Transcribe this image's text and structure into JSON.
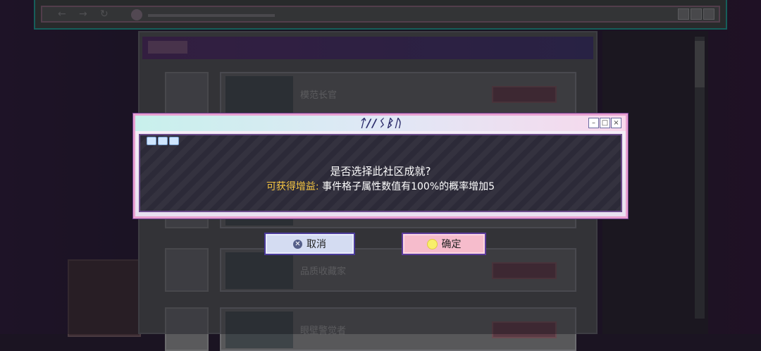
{
  "dialog": {
    "title": "ᛏ//ᛊᛒᚢ",
    "question": "是否选择此社区成就?",
    "benefit_label": "可获得增益:",
    "benefit_text": "事件格子属性数值有100%的概率增加5"
  },
  "buttons": {
    "cancel_label": "取消",
    "confirm_label": "确定"
  },
  "background_list": {
    "rows": [
      {
        "name": "模范长官"
      },
      {
        "name": "品质收藏家"
      },
      {
        "name": "眼壁警觉者"
      }
    ]
  },
  "colors": {
    "benefit_label": "#f5c542",
    "cancel_bg": "#d4dcf2",
    "confirm_bg": "#f6bccc"
  }
}
